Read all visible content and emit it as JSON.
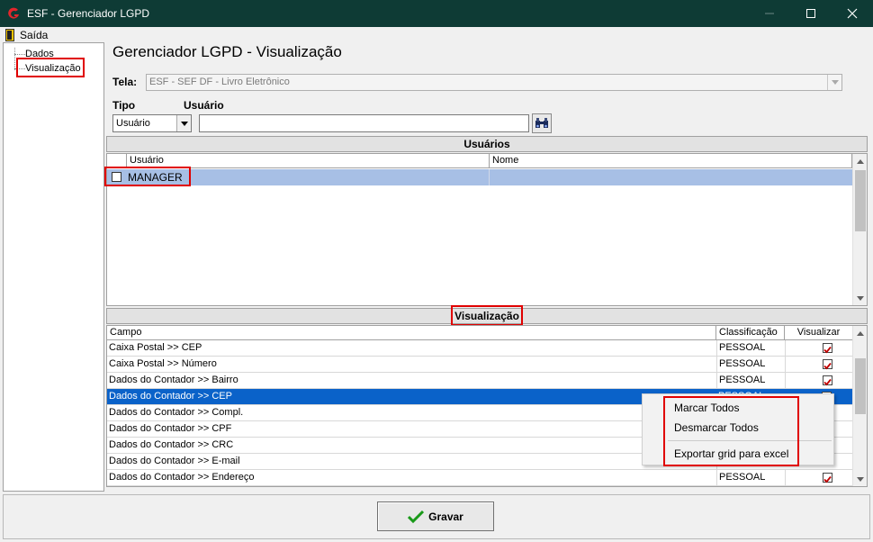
{
  "window": {
    "title": "ESF - Gerenciador LGPD"
  },
  "menu": {
    "exit_label": "Saída"
  },
  "tree": {
    "items": [
      "Dados",
      "Visualização"
    ]
  },
  "page": {
    "title": "Gerenciador LGPD - Visualização"
  },
  "form": {
    "tela_label": "Tela:",
    "tela_value": "ESF - SEF DF - Livro Eletrônico",
    "tipo_label": "Tipo",
    "tipo_value": "Usuário",
    "usuario_label": "Usuário",
    "usuario_value": ""
  },
  "users_section": {
    "header": "Usuários",
    "columns": [
      "Usuário",
      "Nome"
    ],
    "rows": [
      {
        "usuario": "MANAGER",
        "nome": ""
      }
    ]
  },
  "vis_section": {
    "header": "Visualização",
    "columns": [
      "Campo",
      "Classificação",
      "Visualizar"
    ],
    "rows": [
      {
        "campo": "Caixa Postal >> CEP",
        "classificacao": "PESSOAL",
        "checked": true
      },
      {
        "campo": "Caixa Postal >> Número",
        "classificacao": "PESSOAL",
        "checked": true
      },
      {
        "campo": "Dados do Contador >> Bairro",
        "classificacao": "PESSOAL",
        "checked": true
      },
      {
        "campo": "Dados do Contador >> CEP",
        "classificacao": "PESSOAL",
        "checked": true
      },
      {
        "campo": "Dados do Contador >> Compl.",
        "classificacao": "",
        "checked": false
      },
      {
        "campo": "Dados do Contador >> CPF",
        "classificacao": "",
        "checked": false
      },
      {
        "campo": "Dados do Contador >> CRC",
        "classificacao": "",
        "checked": false
      },
      {
        "campo": "Dados do Contador >> E-mail",
        "classificacao": "",
        "checked": false
      },
      {
        "campo": "Dados do Contador >> Endereço",
        "classificacao": "PESSOAL",
        "checked": true
      }
    ]
  },
  "context_menu": {
    "items": [
      "Marcar Todos",
      "Desmarcar Todos",
      "Exportar grid para excel"
    ]
  },
  "footer": {
    "save_label": "Gravar"
  },
  "colors": {
    "titlebar": "#0e3b35",
    "selected_row": "#0a62c9",
    "user_row": "#a7bfe5",
    "highlight_box": "#e00000",
    "check_mark": "#c00000",
    "save_icon": "#1a9a1a"
  },
  "icons": {
    "app": "esf-logo-icon",
    "exit": "exit-door-icon",
    "search": "binoculars-search-icon",
    "save": "green-checkmark-icon"
  }
}
